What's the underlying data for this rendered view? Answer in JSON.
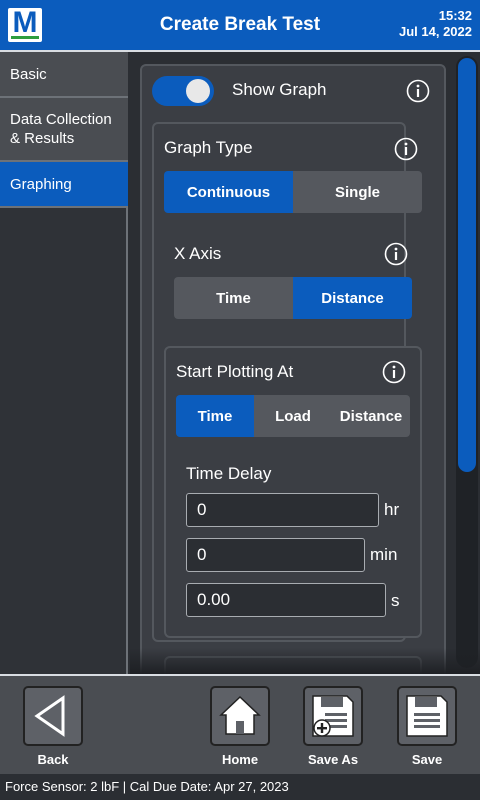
{
  "header": {
    "title": "Create Break Test",
    "time": "15:32",
    "date": "Jul 14, 2022",
    "logo_letter": "M"
  },
  "sidebar": {
    "items": [
      {
        "label": "Basic",
        "active": false
      },
      {
        "label": "Data Collection\n & Results",
        "active": false
      },
      {
        "label": "Graphing",
        "active": true
      }
    ]
  },
  "content": {
    "show_graph": {
      "label": "Show Graph",
      "on": true
    },
    "graph_type": {
      "label": "Graph Type",
      "options": [
        "Continuous",
        "Single"
      ],
      "selected": "Continuous"
    },
    "x_axis": {
      "label": "X Axis",
      "options": [
        "Time",
        "Distance"
      ],
      "selected": "Distance"
    },
    "start_plotting": {
      "label": "Start Plotting At",
      "options": [
        "Time",
        "Load",
        "Distance"
      ],
      "selected": "Time"
    },
    "time_delay": {
      "label": "Time Delay",
      "fields": [
        {
          "value": "0",
          "unit": "hr"
        },
        {
          "value": "0",
          "unit": "min"
        },
        {
          "value": "0.00",
          "unit": "s"
        }
      ]
    }
  },
  "toolbar": {
    "back": "Back",
    "home": "Home",
    "save_as": "Save As",
    "save": "Save"
  },
  "status": {
    "text": "Force Sensor: 2 lbF   |   Cal Due Date: Apr 27, 2023"
  },
  "colors": {
    "accent": "#0b5cbd",
    "panel": "#3b3e44",
    "background": "#2b2e33"
  }
}
